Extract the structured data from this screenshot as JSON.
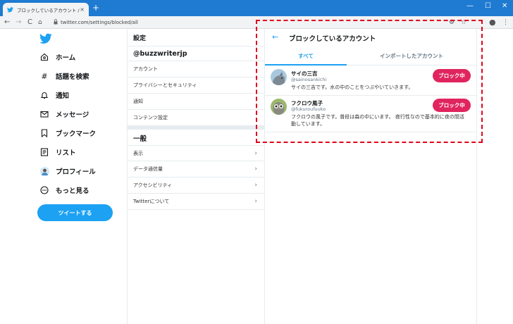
{
  "browser": {
    "tab_title": "ブロックしているアカウント / Twitter",
    "tab_close": "×",
    "new_tab": "+",
    "window_controls": {
      "minimize": "—",
      "maximize": "☐",
      "close": "✕"
    },
    "url": "twitter.com/settings/blocked/all",
    "nav": {
      "back": "←",
      "forward": "→",
      "reload": "C",
      "home": "⌂"
    }
  },
  "sidebar": {
    "items": [
      {
        "label": "ホーム",
        "icon": "home-icon"
      },
      {
        "label": "話題を検索",
        "icon": "hashtag-icon"
      },
      {
        "label": "通知",
        "icon": "bell-icon"
      },
      {
        "label": "メッセージ",
        "icon": "envelope-icon"
      },
      {
        "label": "ブックマーク",
        "icon": "bookmark-icon"
      },
      {
        "label": "リスト",
        "icon": "list-icon"
      },
      {
        "label": "プロフィール",
        "icon": "avatar-icon"
      },
      {
        "label": "もっと見る",
        "icon": "more-icon"
      }
    ],
    "tweet_button": "ツイートする"
  },
  "settings": {
    "header": "設定",
    "username": "@buzzwriterjp",
    "account_items": [
      "アカウント",
      "プライバシーとセキュリティ",
      "通知",
      "コンテンツ設定"
    ],
    "general_header": "一般",
    "general_items": [
      "表示",
      "データ通信量",
      "アクセシビリティ",
      "Twitterについて"
    ],
    "chevron": "›"
  },
  "blocked": {
    "back": "←",
    "title": "ブロックしているアカウント",
    "tabs": {
      "all": "すべて",
      "imported": "インポートしたアカウント"
    },
    "accounts": [
      {
        "name": "サイの三吉",
        "handle": "@sainosankichi",
        "bio": "サイの三吉です。水の中のことをつぶやいていきます。",
        "button": "ブロック中"
      },
      {
        "name": "フクロウ風子",
        "handle": "@fukuroufuuko",
        "bio": "フクロウの風子です。普段は森の中にいます。 夜行性なので基本的に夜の間活動しています。",
        "button": "ブロック中"
      }
    ]
  },
  "colors": {
    "accent": "#1da1f2",
    "block_button": "#e0245e",
    "browser_bar": "#1f7ad1",
    "highlight_frame": "#e0001b"
  }
}
